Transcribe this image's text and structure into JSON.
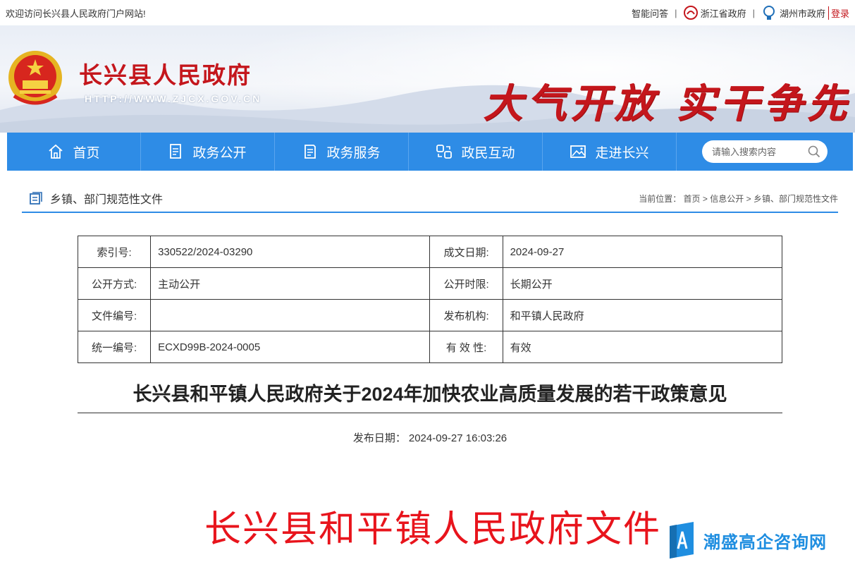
{
  "topbar": {
    "welcome": "欢迎访问长兴县人民政府门户网站!",
    "qa": "智能问答",
    "sep": "|",
    "province": "浙江省政府",
    "city": "湖州市政府",
    "login": "登录"
  },
  "banner": {
    "site_title": "长兴县人民政府",
    "site_url": "HTTP://WWW.ZJCX.GOV.CN",
    "slogan": "大气开放  实干争先"
  },
  "nav": {
    "items": [
      {
        "label": "首页",
        "icon": "home-icon"
      },
      {
        "label": "政务公开",
        "icon": "document-icon"
      },
      {
        "label": "政务服务",
        "icon": "service-icon"
      },
      {
        "label": "政民互动",
        "icon": "interaction-icon"
      },
      {
        "label": "走进长兴",
        "icon": "picture-icon"
      }
    ],
    "search_placeholder": "请输入搜索内容"
  },
  "crumb": {
    "section": "乡镇、部门规范性文件",
    "current_label": "当前位置：",
    "home": "首页",
    "arrow": ">",
    "info": "信息公开",
    "leaf": "乡镇、部门规范性文件"
  },
  "meta": {
    "rows": [
      {
        "k1": "索引号:",
        "v1": "330522/2024-03290",
        "k2": "成文日期:",
        "v2": "2024-09-27"
      },
      {
        "k1": "公开方式:",
        "v1": "主动公开",
        "k2": "公开时限:",
        "v2": "长期公开"
      },
      {
        "k1": "文件编号:",
        "v1": "",
        "k2": "发布机构:",
        "v2": "和平镇人民政府"
      },
      {
        "k1": "统一编号:",
        "v1": "ECXD99B-2024-0005",
        "k2": "有 效 性:",
        "v2": "有效"
      }
    ]
  },
  "document": {
    "title": "长兴县和平镇人民政府关于2024年加快农业高质量发展的若干政策意见",
    "pub_label": "发布日期：",
    "pub_date": "2024-09-27 16:03:26",
    "red_head": "长兴县和平镇人民政府文件"
  },
  "watermark": {
    "text": "潮盛高企咨询网"
  },
  "colors": {
    "nav_blue": "#2e8ce6",
    "gov_red": "#c4161c",
    "doc_red": "#e8141c"
  }
}
